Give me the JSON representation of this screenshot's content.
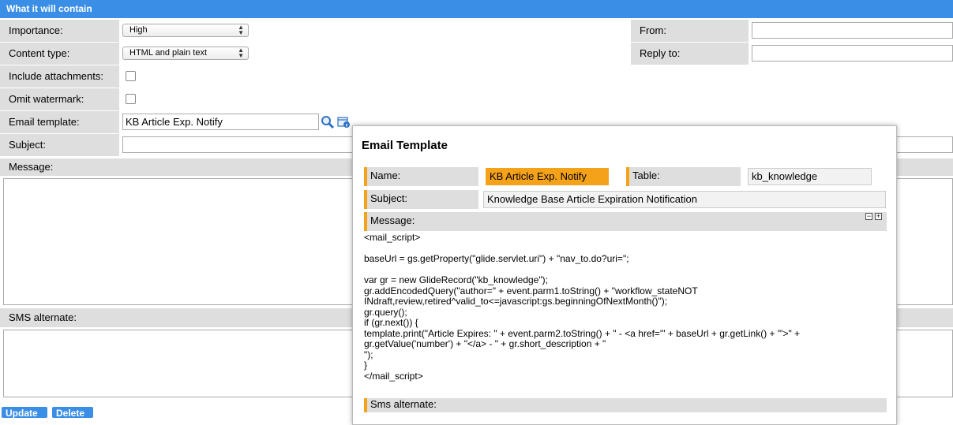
{
  "header": {
    "title": "What it will contain"
  },
  "fields": {
    "importance": {
      "label": "Importance:",
      "value": "High"
    },
    "content_type": {
      "label": "Content type:",
      "value": "HTML and plain text"
    },
    "include_attachments": {
      "label": "Include attachments:"
    },
    "omit_watermark": {
      "label": "Omit watermark:"
    },
    "email_template": {
      "label": "Email template:",
      "value": "KB Article Exp. Notify"
    },
    "subject": {
      "label": "Subject:",
      "value": ""
    },
    "message": {
      "label": "Message:"
    },
    "sms_alternate": {
      "label": "SMS alternate:"
    },
    "from": {
      "label": "From:",
      "value": ""
    },
    "reply_to": {
      "label": "Reply to:",
      "value": ""
    }
  },
  "buttons": {
    "update": "Update",
    "delete": "Delete"
  },
  "popup": {
    "title": "Email Template",
    "name_label": "Name:",
    "name_value": "KB Article Exp. Notify",
    "table_label": "Table:",
    "table_value": "kb_knowledge",
    "subject_label": "Subject:",
    "subject_value": "Knowledge Base Article Expiration Notification",
    "message_label": "Message:",
    "message_code": "<mail_script>\n\nbaseUrl = gs.getProperty(\"glide.servlet.uri\") + \"nav_to.do?uri=\";\n\nvar gr = new GlideRecord(\"kb_knowledge\");\ngr.addEncodedQuery(\"author=\" + event.parm1.toString() + \"workflow_stateNOT\nINdraft,review,retired^valid_to<=javascript:gs.beginningOfNextMonth()\");\ngr.query();\nif (gr.next()) {\ntemplate.print(\"Article Expires: \" + event.parm2.toString() + \" - <a href='\" + baseUrl + gr.getLink() + \"'>\" +\ngr.getValue('number') + \"</a> - \" + gr.short_description + \"\n\");\n}\n</mail_script>",
    "sms_label": "Sms alternate:",
    "collapse_symbol": "−",
    "expand_symbol": "+"
  },
  "colors": {
    "header": "#3a8ee6",
    "accent": "#f5a21b",
    "label_bg": "#dedede"
  }
}
